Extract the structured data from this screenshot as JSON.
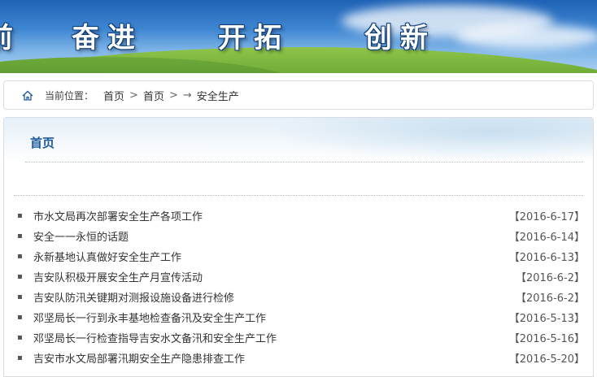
{
  "banner": {
    "slogans": [
      "奋进",
      "开拓",
      "创新"
    ],
    "edge_fragment": "前"
  },
  "breadcrumb": {
    "icon": "home-icon",
    "label": "当前位置：",
    "items": [
      "首页",
      "首页"
    ],
    "separator": ">",
    "arrow": "→",
    "current": "安全生产"
  },
  "panel": {
    "title": "首页"
  },
  "news": [
    {
      "title": "市水文局再次部署安全生产各项工作",
      "date": "【2016-6-17】"
    },
    {
      "title": "安全一一永恒的话题",
      "date": "【2016-6-14】"
    },
    {
      "title": "永新基地认真做好安全生产工作",
      "date": "【2016-6-13】"
    },
    {
      "title": "吉安队积极开展安全生产月宣传活动",
      "date": "【2016-6-2】"
    },
    {
      "title": "吉安队防汛关键期对测报设施设备进行检修",
      "date": "【2016-6-2】"
    },
    {
      "title": "邓坚局长一行到永丰基地检查备汛及安全生产工作",
      "date": "【2016-5-13】"
    },
    {
      "title": "邓坚局长一行检查指导吉安水文备汛和安全生产工作",
      "date": "【2016-5-16】"
    },
    {
      "title": "吉安市水文局部署汛期安全生产隐患排查工作",
      "date": "【2016-5-20】"
    }
  ],
  "colors": {
    "title_blue": "#1e5a9c",
    "sky": "#3f86d2",
    "grass": "#5c9d2a"
  }
}
